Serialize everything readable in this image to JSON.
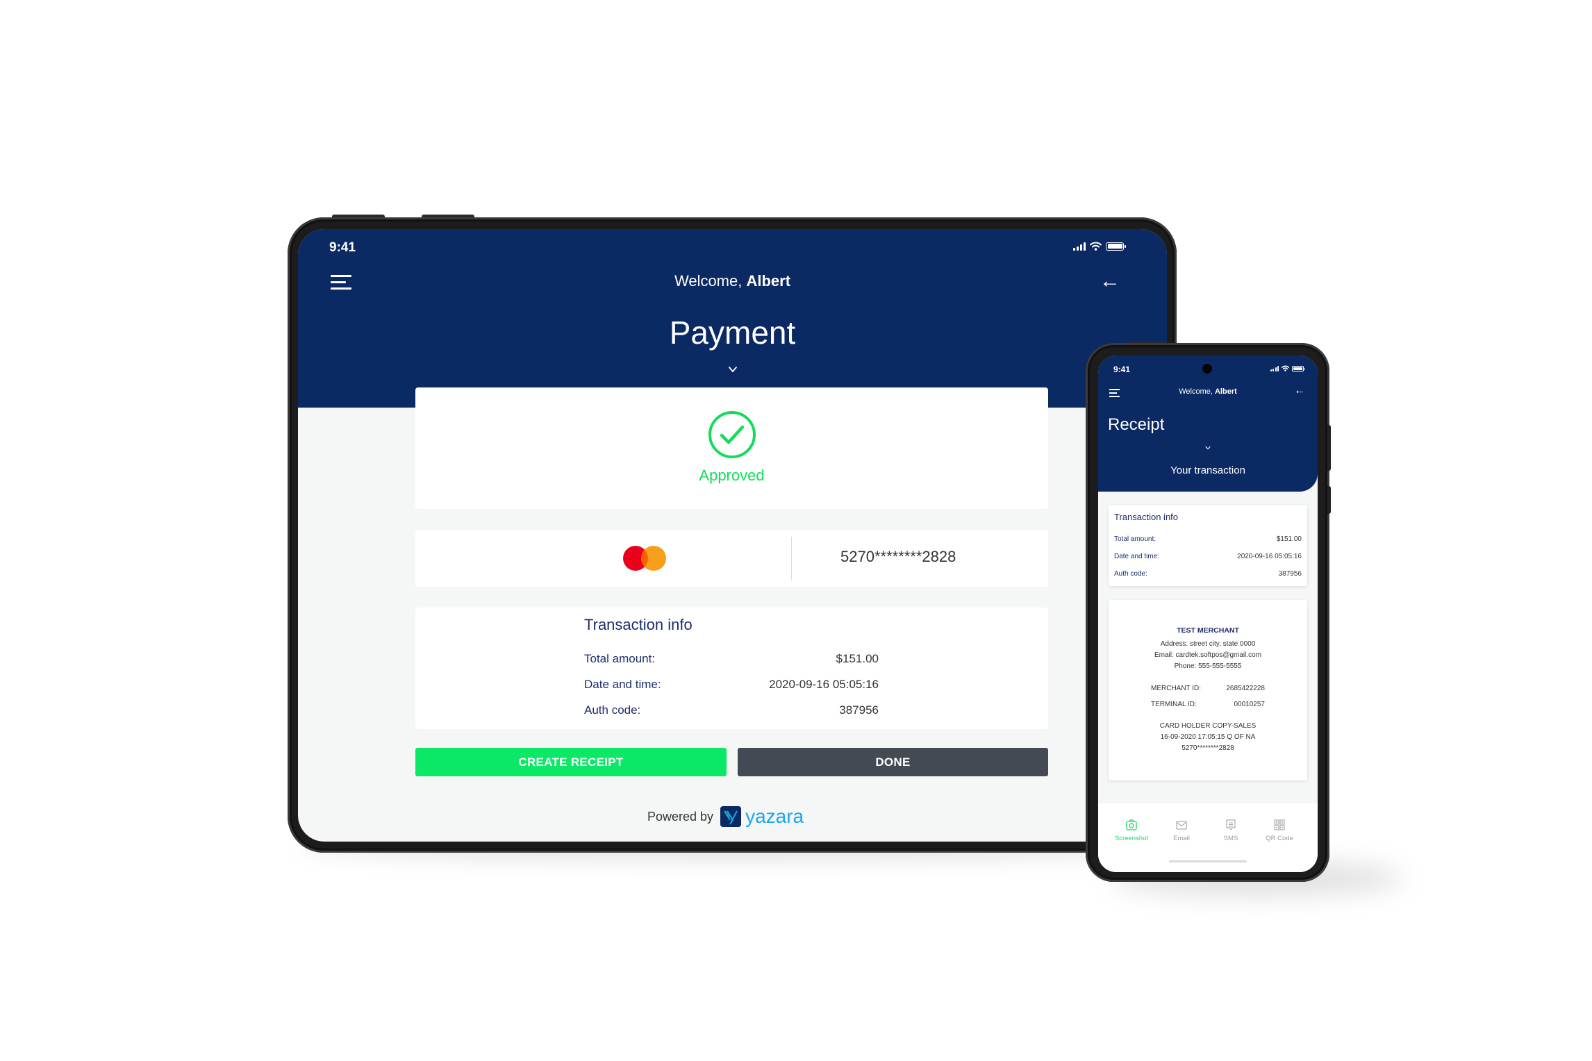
{
  "colors": {
    "navy": "#0b2963",
    "approved_green": "#14dc5a",
    "create_button": "#0be865",
    "done_button": "#434a54",
    "label_navy": "#1c2d6e",
    "yazara_blue": "#1aa6f0"
  },
  "tablet": {
    "status_bar": {
      "time": "9:41",
      "icons": [
        "signal-icon",
        "wifi-icon",
        "battery-icon"
      ]
    },
    "header": {
      "menu_icon": "hamburger-menu-icon",
      "welcome_prefix": "Welcome, ",
      "welcome_name": "Albert",
      "back_icon": "arrow-left-icon",
      "title": "Payment",
      "chevron_icon": "chevron-down-icon"
    },
    "status_card": {
      "icon": "check-circle-icon",
      "label": "Approved"
    },
    "card_info": {
      "brand_icon": "mastercard-logo",
      "number": "5270********2828"
    },
    "transaction_info": {
      "title": "Transaction info",
      "rows": [
        {
          "label": "Total amount:",
          "value": "$151.00"
        },
        {
          "label": "Date and time:",
          "value": "2020-09-16 05:05:16"
        },
        {
          "label": "Auth code:",
          "value": "387956"
        }
      ]
    },
    "buttons": {
      "create_receipt": "CREATE RECEIPT",
      "done": "DONE"
    },
    "footer": {
      "powered_by": "Powered by",
      "brand": "yazara"
    }
  },
  "phone": {
    "status_bar": {
      "time": "9:41",
      "icons": [
        "signal-icon",
        "wifi-icon",
        "battery-icon"
      ]
    },
    "header": {
      "menu_icon": "hamburger-menu-icon",
      "welcome_prefix": "Welcome, ",
      "welcome_name": "Albert",
      "back_icon": "arrow-left-icon",
      "title": "Receipt",
      "chevron_icon": "chevron-down-icon",
      "subtitle": "Your transaction"
    },
    "transaction_info": {
      "title": "Transaction info",
      "rows": [
        {
          "label": "Total amount:",
          "value": "$151.00"
        },
        {
          "label": "Date and time:",
          "value": "2020-09-16 05:05:16"
        },
        {
          "label": "Auth code:",
          "value": "387956"
        }
      ]
    },
    "receipt": {
      "merchant_name": "TEST MERCHANT",
      "address": "Address: street city, state 0000",
      "email": "Email: cardtek.softpos@gmail.com",
      "phone": "Phone: 555-555-5555",
      "merchant_id_label": "MERCHANT ID:",
      "merchant_id": "2685422228",
      "terminal_id_label": "TERMINAL ID:",
      "terminal_id": "00010257",
      "copy_type": "CARD HOLDER COPY-SALES",
      "datetime_line": "16-09-2020 17:05:15 Q OF NA",
      "card_number": "5270********2828"
    },
    "tabs": [
      {
        "label": "Screenshot",
        "icon": "camera-icon",
        "active": true
      },
      {
        "label": "Email",
        "icon": "envelope-icon",
        "active": false
      },
      {
        "label": "SMS",
        "icon": "message-icon",
        "active": false
      },
      {
        "label": "QR Code",
        "icon": "qr-code-icon",
        "active": false
      }
    ]
  }
}
